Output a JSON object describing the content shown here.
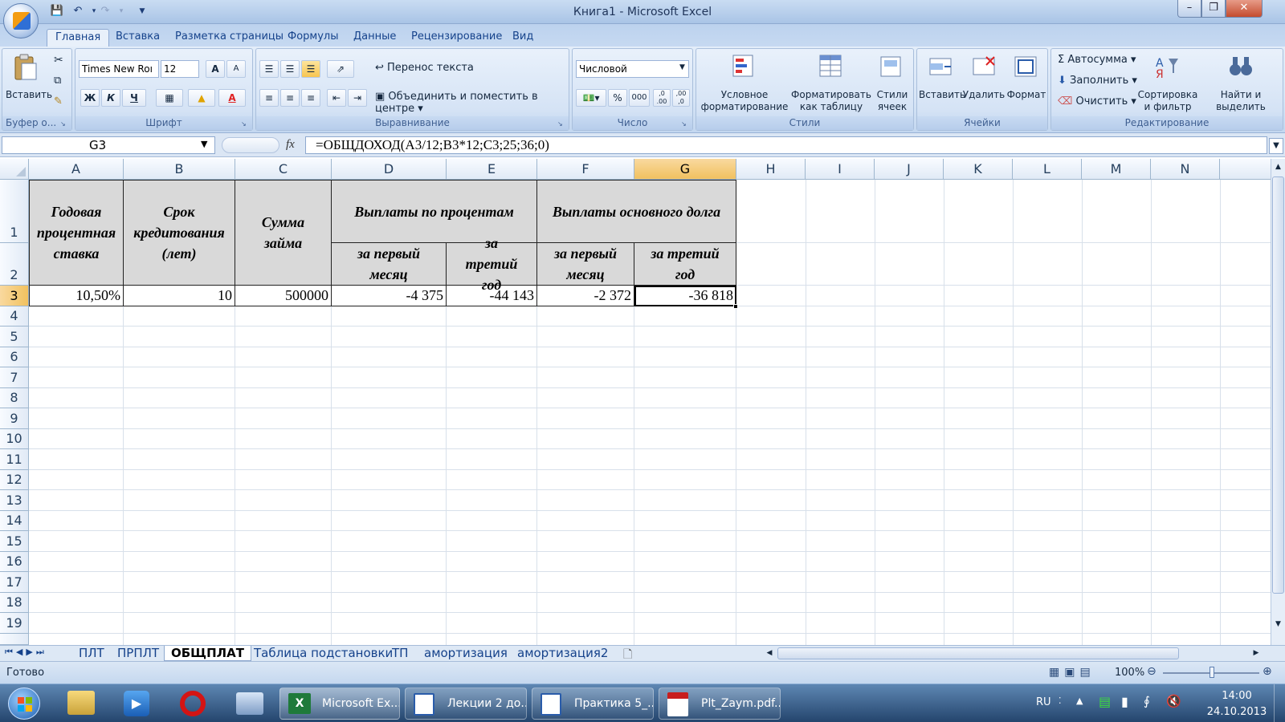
{
  "window": {
    "title": "Книга1 - Microsoft Excel",
    "min": "–",
    "max": "❐",
    "close": "✕"
  },
  "ribbon_tabs": [
    "Главная",
    "Вставка",
    "Разметка страницы",
    "Формулы",
    "Данные",
    "Рецензирование",
    "Вид"
  ],
  "clipboard": {
    "label": "Буфер о...",
    "paste": "Вставить"
  },
  "font": {
    "label": "Шрифт",
    "name": "Times New Roı",
    "size": "12",
    "bold": "Ж",
    "italic": "К",
    "underline": "Ч",
    "grow": "A",
    "shrink": "A",
    "fontcolor": "A"
  },
  "alignment": {
    "label": "Выравнивание",
    "wrap": "Перенос текста",
    "merge": "Объединить и поместить в центре"
  },
  "number": {
    "label": "Число",
    "format": "Числовой",
    "percent": "%",
    "thousands": "000",
    "inc": ",0 .00",
    "dec": ",00 ,0"
  },
  "styles": {
    "label": "Стили",
    "conditional": "Условное форматирование",
    "astable": "Форматировать как таблицу",
    "cellstyles": "Стили ячеек"
  },
  "cells": {
    "label": "Ячейки",
    "insert": "Вставить",
    "delete": "Удалить",
    "format": "Формат"
  },
  "editing": {
    "label": "Редактирование",
    "autosum": "Автосумма",
    "fill": "Заполнить",
    "clear": "Очистить",
    "sort": "Сортировка и фильтр",
    "find": "Найти и выделить"
  },
  "formula_bar": {
    "namebox": "G3",
    "fx": "fx",
    "formula": "=ОБЩДОХОД(A3/12;B3*12;C3;25;36;0)"
  },
  "columns": [
    "A",
    "B",
    "C",
    "D",
    "E",
    "F",
    "G",
    "H",
    "I",
    "J",
    "K",
    "L",
    "M",
    "N"
  ],
  "rows": [
    "1",
    "2",
    "3",
    "4",
    "5",
    "6",
    "7",
    "8",
    "9",
    "10",
    "11",
    "12",
    "13",
    "14",
    "15",
    "16",
    "17",
    "18",
    "19"
  ],
  "table": {
    "h_rate": "Годовая процентная ставка",
    "h_term": "Срок кредитования (лет)",
    "h_sum": "Сумма займа",
    "h_interest": "Выплаты по процентам",
    "h_principal": "Выплаты основного долга",
    "h_first_month_1": "за первый месяц",
    "h_third_year_1": "за третий год",
    "h_first_month_2": "за первый месяц",
    "h_third_year_2": "за третий год",
    "v_rate": "10,50%",
    "v_term": "10",
    "v_sum": "500000",
    "v_int_first": "-4 375",
    "v_int_third": "-44 143",
    "v_prin_first": "-2 372",
    "v_prin_third": "-36 818"
  },
  "sheets": [
    "ПЛТ",
    "ПРПЛТ",
    "ОБЩПЛАТ",
    "Таблица подстановки",
    "ТП",
    "амортизация",
    "амортизация2"
  ],
  "active_sheet": "ОБЩПЛАТ",
  "status": {
    "ready": "Готово",
    "zoom": "100%"
  },
  "taskbar": {
    "items": [
      "Microsoft Ex...",
      "Лекции 2 до...",
      "Практика 5_...",
      "Plt_Zaym.pdf..."
    ],
    "lang": "RU",
    "time": "14:00",
    "date": "24.10.2013"
  }
}
